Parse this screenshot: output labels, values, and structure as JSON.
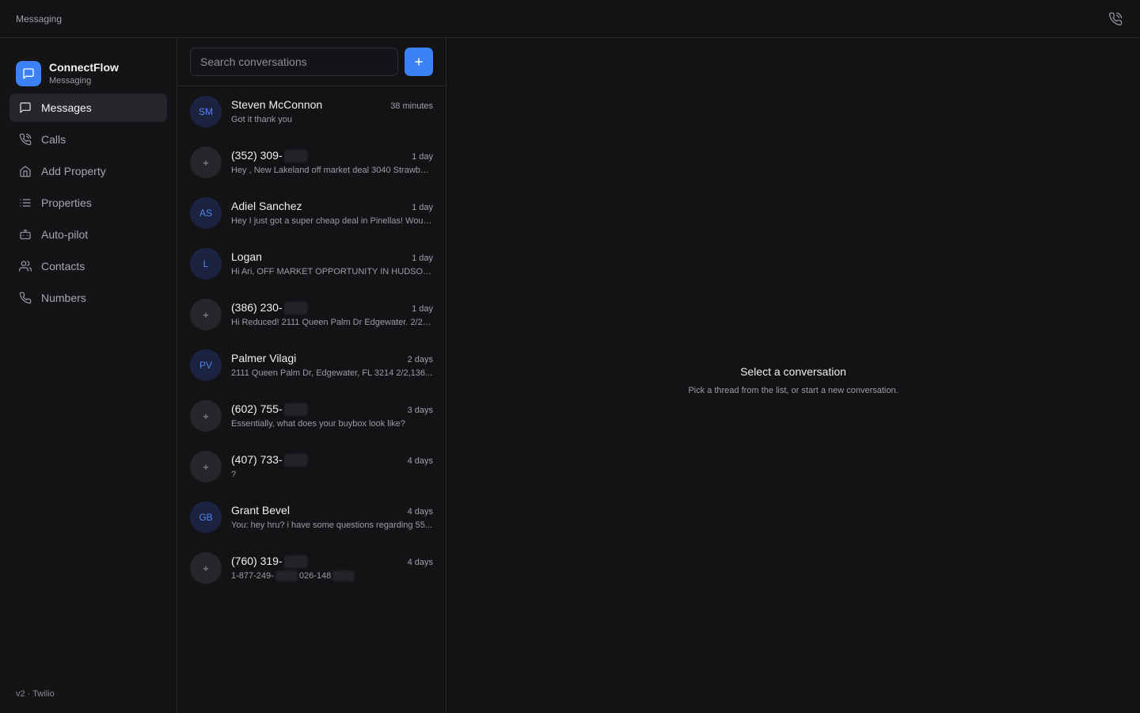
{
  "topbar": {
    "title": "Messaging",
    "call_icon": "phone-call-icon"
  },
  "brand": {
    "name": "ConnectFlow",
    "subtitle": "Messaging",
    "logo_icon": "chat-bubble-icon",
    "accent": "#3b82f6"
  },
  "nav": [
    {
      "label": "Messages",
      "icon": "chat-bubble-icon",
      "active": true
    },
    {
      "label": "Calls",
      "icon": "phone-call-icon",
      "active": false
    },
    {
      "label": "Add Property",
      "icon": "home-icon",
      "active": false
    },
    {
      "label": "Properties",
      "icon": "list-icon",
      "active": false
    },
    {
      "label": "Auto-pilot",
      "icon": "robot-icon",
      "active": false
    },
    {
      "label": "Contacts",
      "icon": "users-icon",
      "active": false
    },
    {
      "label": "Numbers",
      "icon": "phone-icon",
      "active": false
    }
  ],
  "version": "v2 · Twilio",
  "search": {
    "placeholder": "Search conversations"
  },
  "new_button_icon": "plus-icon",
  "conversations": [
    {
      "avatar": "SM",
      "name": "Steven McConnon",
      "time": "38 minutes",
      "preview": "Got it thank you"
    },
    {
      "avatar": "+",
      "name": "(352) 309-",
      "time": "1 day",
      "preview": "Hey , New Lakeland off market deal 3040 Strawberry..."
    },
    {
      "avatar": "AS",
      "name": "Adiel Sanchez",
      "time": "1 day",
      "preview": "Hey I just got a super cheap deal in Pinellas! Would..."
    },
    {
      "avatar": "L",
      "name": "Logan",
      "time": "1 day",
      "preview": "Hi Ari, OFF MARKET OPPORTUNITY IN HUDSON..."
    },
    {
      "avatar": "+",
      "name": "(386) 230-",
      "time": "1 day",
      "preview": "Hi Reduced! 2111 Queen Palm Dr Edgewater. 2/2, ..."
    },
    {
      "avatar": "PV",
      "name": "Palmer Vilagi",
      "time": "2 days",
      "preview": "2111 Queen Palm Dr, Edgewater, FL 3214 2/2,136..."
    },
    {
      "avatar": "+",
      "name": "(602) 755-",
      "time": "3 days",
      "preview": "Essentially, what does your buybox look like?"
    },
    {
      "avatar": "+",
      "name": "(407) 733-",
      "time": "4 days",
      "preview": "?"
    },
    {
      "avatar": "GB",
      "name": "Grant Bevel",
      "time": "4 days",
      "preview": "You: hey hru? i have some questions regarding 55..."
    },
    {
      "avatar": "+",
      "name": "(760) 319-",
      "time": "4 days",
      "preview_a": "1-877-249-",
      "preview_b": "026-148"
    }
  ],
  "empty_state": {
    "title": "Select a conversation",
    "subtitle": "Pick a thread from the list, or start a new conversation."
  }
}
